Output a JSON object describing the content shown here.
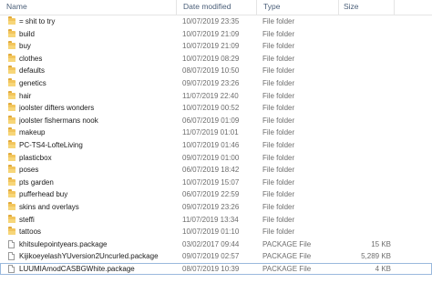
{
  "columns": {
    "name": "Name",
    "date_modified": "Date modified",
    "type": "Type",
    "size": "Size"
  },
  "colors": {
    "folder": "#f2c55c",
    "header_text": "#4c607a",
    "secondary_text": "#6d6d6d",
    "selection_border": "#9ab9dd"
  },
  "rows": [
    {
      "icon": "folder-icon",
      "name": "= shit to try",
      "date": "10/07/2019 23:35",
      "type": "File folder",
      "size": ""
    },
    {
      "icon": "folder-icon",
      "name": "build",
      "date": "10/07/2019 21:09",
      "type": "File folder",
      "size": ""
    },
    {
      "icon": "folder-icon",
      "name": "buy",
      "date": "10/07/2019 21:09",
      "type": "File folder",
      "size": ""
    },
    {
      "icon": "folder-icon",
      "name": "clothes",
      "date": "10/07/2019 08:29",
      "type": "File folder",
      "size": ""
    },
    {
      "icon": "folder-icon",
      "name": "defaults",
      "date": "08/07/2019 10:50",
      "type": "File folder",
      "size": ""
    },
    {
      "icon": "folder-icon",
      "name": "genetics",
      "date": "09/07/2019 23:26",
      "type": "File folder",
      "size": ""
    },
    {
      "icon": "folder-icon",
      "name": "hair",
      "date": "11/07/2019 22:40",
      "type": "File folder",
      "size": ""
    },
    {
      "icon": "folder-icon",
      "name": "joolster difters wonders",
      "date": "10/07/2019 00:52",
      "type": "File folder",
      "size": ""
    },
    {
      "icon": "folder-icon",
      "name": "joolster fishermans nook",
      "date": "06/07/2019 01:09",
      "type": "File folder",
      "size": ""
    },
    {
      "icon": "folder-icon",
      "name": "makeup",
      "date": "11/07/2019 01:01",
      "type": "File folder",
      "size": ""
    },
    {
      "icon": "folder-icon",
      "name": "PC-TS4-LofteLiving",
      "date": "10/07/2019 01:46",
      "type": "File folder",
      "size": ""
    },
    {
      "icon": "folder-icon",
      "name": "plasticbox",
      "date": "09/07/2019 01:00",
      "type": "File folder",
      "size": ""
    },
    {
      "icon": "folder-icon",
      "name": "poses",
      "date": "06/07/2019 18:42",
      "type": "File folder",
      "size": ""
    },
    {
      "icon": "folder-icon",
      "name": "pts garden",
      "date": "10/07/2019 15:07",
      "type": "File folder",
      "size": ""
    },
    {
      "icon": "folder-icon",
      "name": "pufferhead buy",
      "date": "06/07/2019 22:59",
      "type": "File folder",
      "size": ""
    },
    {
      "icon": "folder-icon",
      "name": "skins and overlays",
      "date": "09/07/2019 23:26",
      "type": "File folder",
      "size": ""
    },
    {
      "icon": "folder-icon",
      "name": "steffi",
      "date": "11/07/2019 13:34",
      "type": "File folder",
      "size": ""
    },
    {
      "icon": "folder-icon",
      "name": "tattoos",
      "date": "10/07/2019 01:10",
      "type": "File folder",
      "size": ""
    },
    {
      "icon": "file-icon",
      "name": "khitsulepointyears.package",
      "date": "03/02/2017 09:44",
      "type": "PACKAGE File",
      "size": "15 KB"
    },
    {
      "icon": "file-icon",
      "name": "KijikoeyelashYUversion2Uncurled.package",
      "date": "09/07/2019 02:57",
      "type": "PACKAGE File",
      "size": "5,289 KB"
    },
    {
      "icon": "file-icon",
      "name": "LUUMIAmodCASBGWhite.package",
      "date": "08/07/2019 10:39",
      "type": "PACKAGE File",
      "size": "4 KB",
      "selected": true
    }
  ]
}
